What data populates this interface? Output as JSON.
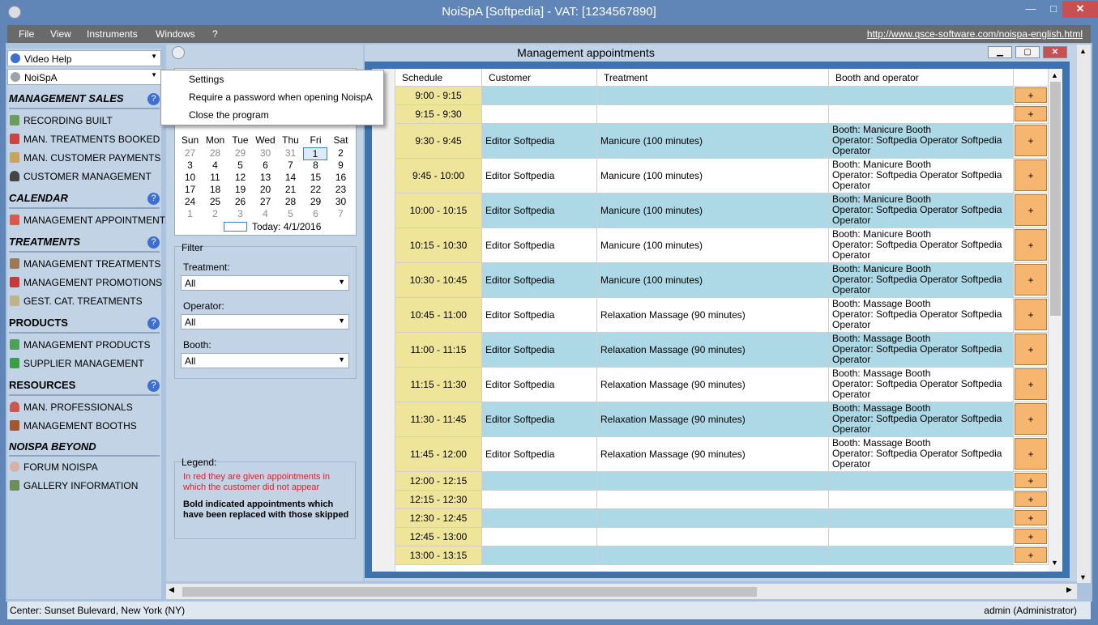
{
  "window": {
    "title": "NoiSpA [Softpedia] - VAT: [1234567890]",
    "min": "—",
    "max": "□",
    "close": "✕"
  },
  "menu": {
    "items": [
      "File",
      "View",
      "Instruments",
      "Windows",
      "?"
    ],
    "url": "http://www.qsce-software.com/noispa-english.html"
  },
  "nav": {
    "video_help": "Video Help",
    "selector": "NoiSpA",
    "help_glyph": "?",
    "sections": [
      {
        "title": "MANAGEMENT SALES",
        "items": [
          "RECORDING BUILT",
          "MAN. TREATMENTS BOOKED",
          "MAN. CUSTOMER PAYMENTS",
          "CUSTOMER MANAGEMENT"
        ]
      },
      {
        "title": "CALENDAR",
        "items": [
          "MANAGEMENT APPOINTMENTS"
        ]
      },
      {
        "title": "TREATMENTS",
        "items": [
          "MANAGEMENT TREATMENTS",
          "MANAGEMENT PROMOTIONS",
          "GEST. CAT. TREATMENTS"
        ]
      },
      {
        "title": "PRODUCTS",
        "items": [
          "MANAGEMENT PRODUCTS",
          "SUPPLIER MANAGEMENT"
        ]
      },
      {
        "title": "RESOURCES",
        "items": [
          "MAN. PROFESSIONALS",
          "MANAGEMENT BOOTHS"
        ]
      },
      {
        "title": "NOISPA BEYOND",
        "items": [
          "FORUM NOISPA",
          "GALLERY INFORMATION"
        ]
      }
    ]
  },
  "popup_menu": {
    "items": [
      "Settings",
      "Require a password when opening NoispA",
      "Close the program"
    ]
  },
  "calendar": {
    "days": [
      "Sun",
      "Mon",
      "Tue",
      "Wed",
      "Thu",
      "Fri",
      "Sat"
    ],
    "weeks": [
      [
        "27",
        "28",
        "29",
        "30",
        "31",
        "1",
        "2"
      ],
      [
        "3",
        "4",
        "5",
        "6",
        "7",
        "8",
        "9"
      ],
      [
        "10",
        "11",
        "12",
        "13",
        "14",
        "15",
        "16"
      ],
      [
        "17",
        "18",
        "19",
        "20",
        "21",
        "22",
        "23"
      ],
      [
        "24",
        "25",
        "26",
        "27",
        "28",
        "29",
        "30"
      ],
      [
        "1",
        "2",
        "3",
        "4",
        "5",
        "6",
        "7"
      ]
    ],
    "today_label": "Today: 4/1/2016"
  },
  "filter": {
    "title": "Filter",
    "treatment_label": "Treatment:",
    "treatment_value": "All",
    "operator_label": "Operator:",
    "operator_value": "All",
    "booth_label": "Booth:",
    "booth_value": "All"
  },
  "legend": {
    "title": "Legend:",
    "red_text": "In red they are given appointments in which the customer did not appear",
    "bold_text": "Bold indicated appointments which have been replaced with those skipped"
  },
  "appointments": {
    "title": "Management appointments",
    "columns": [
      "Schedule",
      "Customer",
      "Treatment",
      "Booth and operator"
    ],
    "add_label": "+",
    "rows": [
      {
        "time": "9:00 - 9:15",
        "customer": "",
        "treatment": "",
        "booth": [],
        "shade": true
      },
      {
        "time": "9:15 - 9:30",
        "customer": "",
        "treatment": "",
        "booth": [],
        "shade": false
      },
      {
        "time": "9:30 - 9:45",
        "customer": "Editor Softpedia",
        "treatment": "Manicure (100 minutes)",
        "booth": [
          "Booth: Manicure Booth",
          "Operator: Softpedia Operator Softpedia",
          "Operator"
        ],
        "shade": true
      },
      {
        "time": "9:45 - 10:00",
        "customer": "Editor Softpedia",
        "treatment": "Manicure (100 minutes)",
        "booth": [
          "Booth: Manicure Booth",
          "Operator: Softpedia Operator Softpedia",
          "Operator"
        ],
        "shade": false
      },
      {
        "time": "10:00 - 10:15",
        "customer": "Editor Softpedia",
        "treatment": "Manicure (100 minutes)",
        "booth": [
          "Booth: Manicure Booth",
          "Operator: Softpedia Operator Softpedia",
          "Operator"
        ],
        "shade": true
      },
      {
        "time": "10:15 - 10:30",
        "customer": "Editor Softpedia",
        "treatment": "Manicure (100 minutes)",
        "booth": [
          "Booth: Manicure Booth",
          "Operator: Softpedia Operator Softpedia",
          "Operator"
        ],
        "shade": false
      },
      {
        "time": "10:30 - 10:45",
        "customer": "Editor Softpedia",
        "treatment": "Manicure (100 minutes)",
        "booth": [
          "Booth: Manicure Booth",
          "Operator: Softpedia Operator Softpedia",
          "Operator"
        ],
        "shade": true
      },
      {
        "time": "10:45 - 11:00",
        "customer": "Editor Softpedia",
        "treatment": "Relaxation Massage (90 minutes)",
        "booth": [
          "Booth: Massage Booth",
          "Operator: Softpedia Operator Softpedia",
          "Operator"
        ],
        "shade": false
      },
      {
        "time": "11:00 - 11:15",
        "customer": "Editor Softpedia",
        "treatment": "Relaxation Massage (90 minutes)",
        "booth": [
          "Booth: Massage Booth",
          "Operator: Softpedia Operator Softpedia",
          "Operator"
        ],
        "shade": true
      },
      {
        "time": "11:15 - 11:30",
        "customer": "Editor Softpedia",
        "treatment": "Relaxation Massage (90 minutes)",
        "booth": [
          "Booth: Massage Booth",
          "Operator: Softpedia Operator Softpedia",
          "Operator"
        ],
        "shade": false
      },
      {
        "time": "11:30 - 11:45",
        "customer": "Editor Softpedia",
        "treatment": "Relaxation Massage (90 minutes)",
        "booth": [
          "Booth: Massage Booth",
          "Operator: Softpedia Operator Softpedia",
          "Operator"
        ],
        "shade": true
      },
      {
        "time": "11:45 - 12:00",
        "customer": "Editor Softpedia",
        "treatment": "Relaxation Massage (90 minutes)",
        "booth": [
          "Booth: Massage Booth",
          "Operator: Softpedia Operator Softpedia",
          "Operator"
        ],
        "shade": false
      },
      {
        "time": "12:00 - 12:15",
        "customer": "",
        "treatment": "",
        "booth": [],
        "shade": true
      },
      {
        "time": "12:15 - 12:30",
        "customer": "",
        "treatment": "",
        "booth": [],
        "shade": false
      },
      {
        "time": "12:30 - 12:45",
        "customer": "",
        "treatment": "",
        "booth": [],
        "shade": true
      },
      {
        "time": "12:45 - 13:00",
        "customer": "",
        "treatment": "",
        "booth": [],
        "shade": false
      },
      {
        "time": "13:00 - 13:15",
        "customer": "",
        "treatment": "",
        "booth": [],
        "shade": true
      }
    ]
  },
  "status": {
    "left": "Center: Sunset Bulevard,  New York (NY)",
    "right": "admin (Administrator)"
  },
  "colors": {
    "shade_row": "#add8e6",
    "time_cell": "#efe59a",
    "add_button": "#f6b66f",
    "legend_red": "#e02020",
    "help_blue": "#3d6fd0"
  }
}
